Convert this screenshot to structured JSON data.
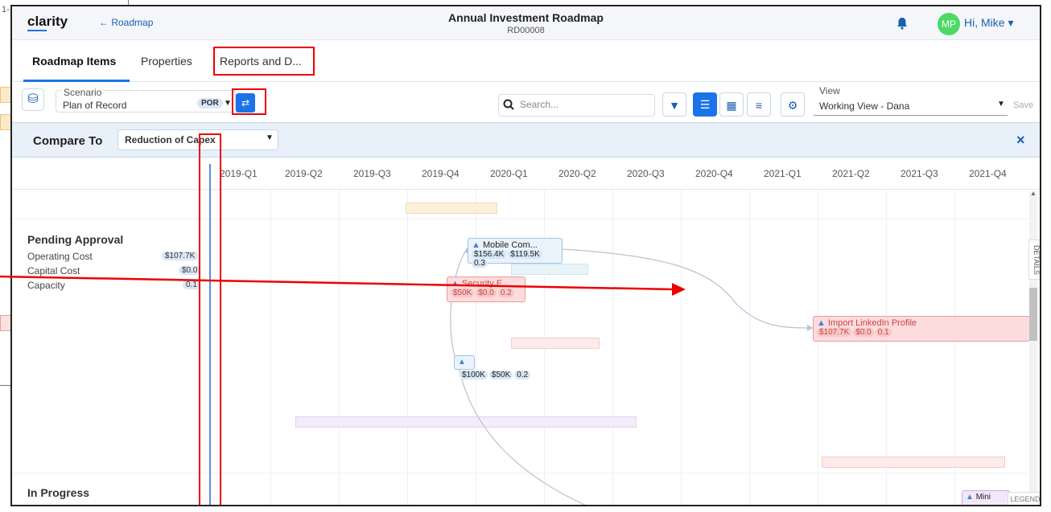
{
  "background_window": {
    "snippet": "1-"
  },
  "header": {
    "logo": "clarity",
    "back_link": "← Roadmap",
    "title": "Annual Investment Roadmap",
    "subtitle": "RD00008",
    "avatar_initials": "MP",
    "greeting": "Hi, Mike"
  },
  "tabs": [
    {
      "label": "Roadmap Items",
      "active": true
    },
    {
      "label": "Properties"
    },
    {
      "label": "Reports and D..."
    }
  ],
  "toolbar": {
    "scenario_label": "Scenario",
    "scenario_value": "Plan of Record",
    "scenario_badge": "POR",
    "search_placeholder": "Search...",
    "view_label": "View",
    "view_value": "Working View - Dana",
    "save_label": "Save"
  },
  "compare": {
    "label": "Compare To",
    "value": "Reduction of Capex",
    "close": "×"
  },
  "timeline": {
    "quarters": [
      "2019-Q1",
      "2019-Q2",
      "2019-Q3",
      "2019-Q4",
      "2020-Q1",
      "2020-Q2",
      "2020-Q3",
      "2020-Q4",
      "2021-Q1",
      "2021-Q2",
      "2021-Q3",
      "2021-Q4"
    ]
  },
  "groups": [
    {
      "name": "Pending Approval",
      "metrics": [
        {
          "label": "Operating Cost",
          "value": "$107.7K"
        },
        {
          "label": "Capital Cost",
          "value": "$0.0"
        },
        {
          "label": "Capacity",
          "value": "0.1"
        }
      ]
    },
    {
      "name": "In Progress"
    }
  ],
  "cards": [
    {
      "title": "Mobile Com...",
      "values": [
        "$156.4K",
        "$119.5K",
        "0.3"
      ]
    },
    {
      "title": "Security E...",
      "values": [
        "$50K",
        "$0.0",
        "0.2"
      ]
    },
    {
      "title": "",
      "values": [
        "$100K",
        "$50K",
        "0.2"
      ]
    },
    {
      "title": "Import LinkedIn Profile",
      "values": [
        "$107.7K",
        "$0.0",
        "0.1"
      ]
    },
    {
      "title": "Mini",
      "values": []
    }
  ],
  "side": {
    "details": "DETAILS",
    "legend": "LEGEND"
  },
  "colors": {
    "accent": "#1a73e8",
    "annotation": "#e00000",
    "avatar": "#4cd964"
  }
}
